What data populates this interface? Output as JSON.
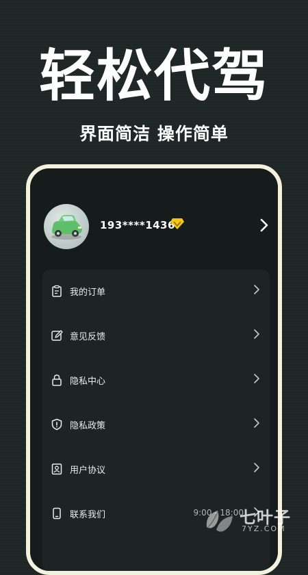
{
  "hero": {
    "title": "轻松代驾",
    "subtitle": "界面简洁 操作简单"
  },
  "profile": {
    "phone": "193****1436",
    "vip_icon": "diamond-icon",
    "chevron_icon": "chevron-right-icon"
  },
  "menu": {
    "items": [
      {
        "label": "我的订单",
        "icon": "clipboard-icon"
      },
      {
        "label": "意见反馈",
        "icon": "edit-icon"
      },
      {
        "label": "隐私中心",
        "icon": "lock-icon"
      },
      {
        "label": "隐私政策",
        "icon": "shield-icon"
      },
      {
        "label": "用户协议",
        "icon": "user-document-icon"
      },
      {
        "label": "联系我们",
        "icon": "phone-icon",
        "extra": "9:00 - 18:00"
      }
    ]
  },
  "watermark": {
    "text": "七叶子",
    "domain": "7YZ.COM"
  },
  "colors": {
    "background": "#1f2726",
    "phone_frame": "#f4f1df",
    "card": "#1d2423",
    "vip": "#f5c518"
  }
}
